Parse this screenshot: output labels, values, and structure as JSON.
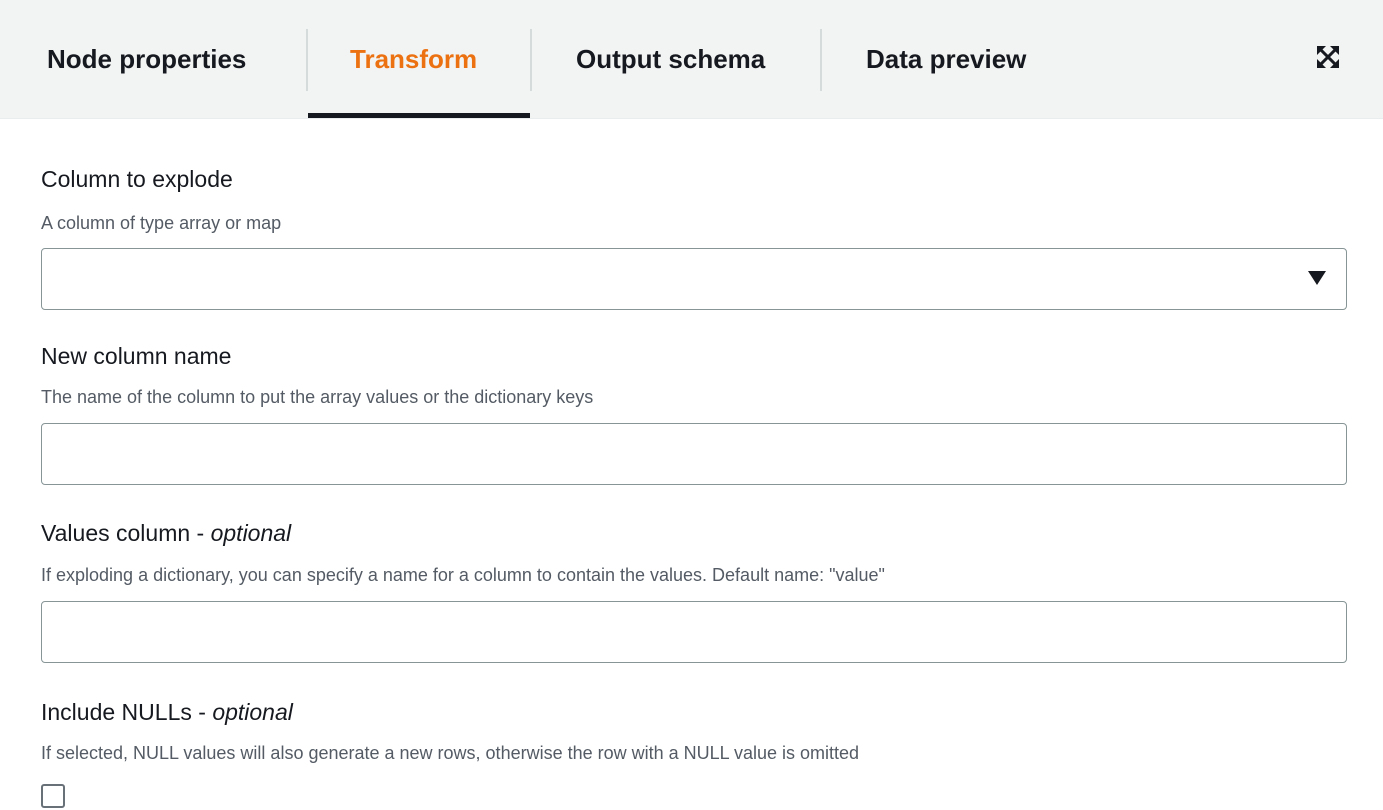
{
  "tabs": {
    "node_properties": "Node properties",
    "transform": "Transform",
    "output_schema": "Output schema",
    "data_preview": "Data preview",
    "active": "transform"
  },
  "colors": {
    "active_tab": "#ec7211",
    "tab_bar_bg": "#f2f3f3",
    "text": "#16191f",
    "description": "#545b64",
    "border": "#879596"
  },
  "icons": {
    "expand": "expand-icon",
    "dropdown": "caret-down-icon"
  },
  "fields": {
    "column_to_explode": {
      "label": "Column to explode",
      "description": "A column of type array or map",
      "value": ""
    },
    "new_column_name": {
      "label": "New column name",
      "description": "The name of the column to put the array values or the dictionary keys",
      "value": ""
    },
    "values_column": {
      "label": "Values column - ",
      "optional": "optional",
      "description": "If exploding a dictionary, you can specify a name for a column to contain the values. Default name: \"value\"",
      "value": ""
    },
    "include_nulls": {
      "label": "Include NULLs - ",
      "optional": "optional",
      "description": "If selected, NULL values will also generate a new rows, otherwise the row with a NULL value is omitted",
      "checked": false
    }
  }
}
